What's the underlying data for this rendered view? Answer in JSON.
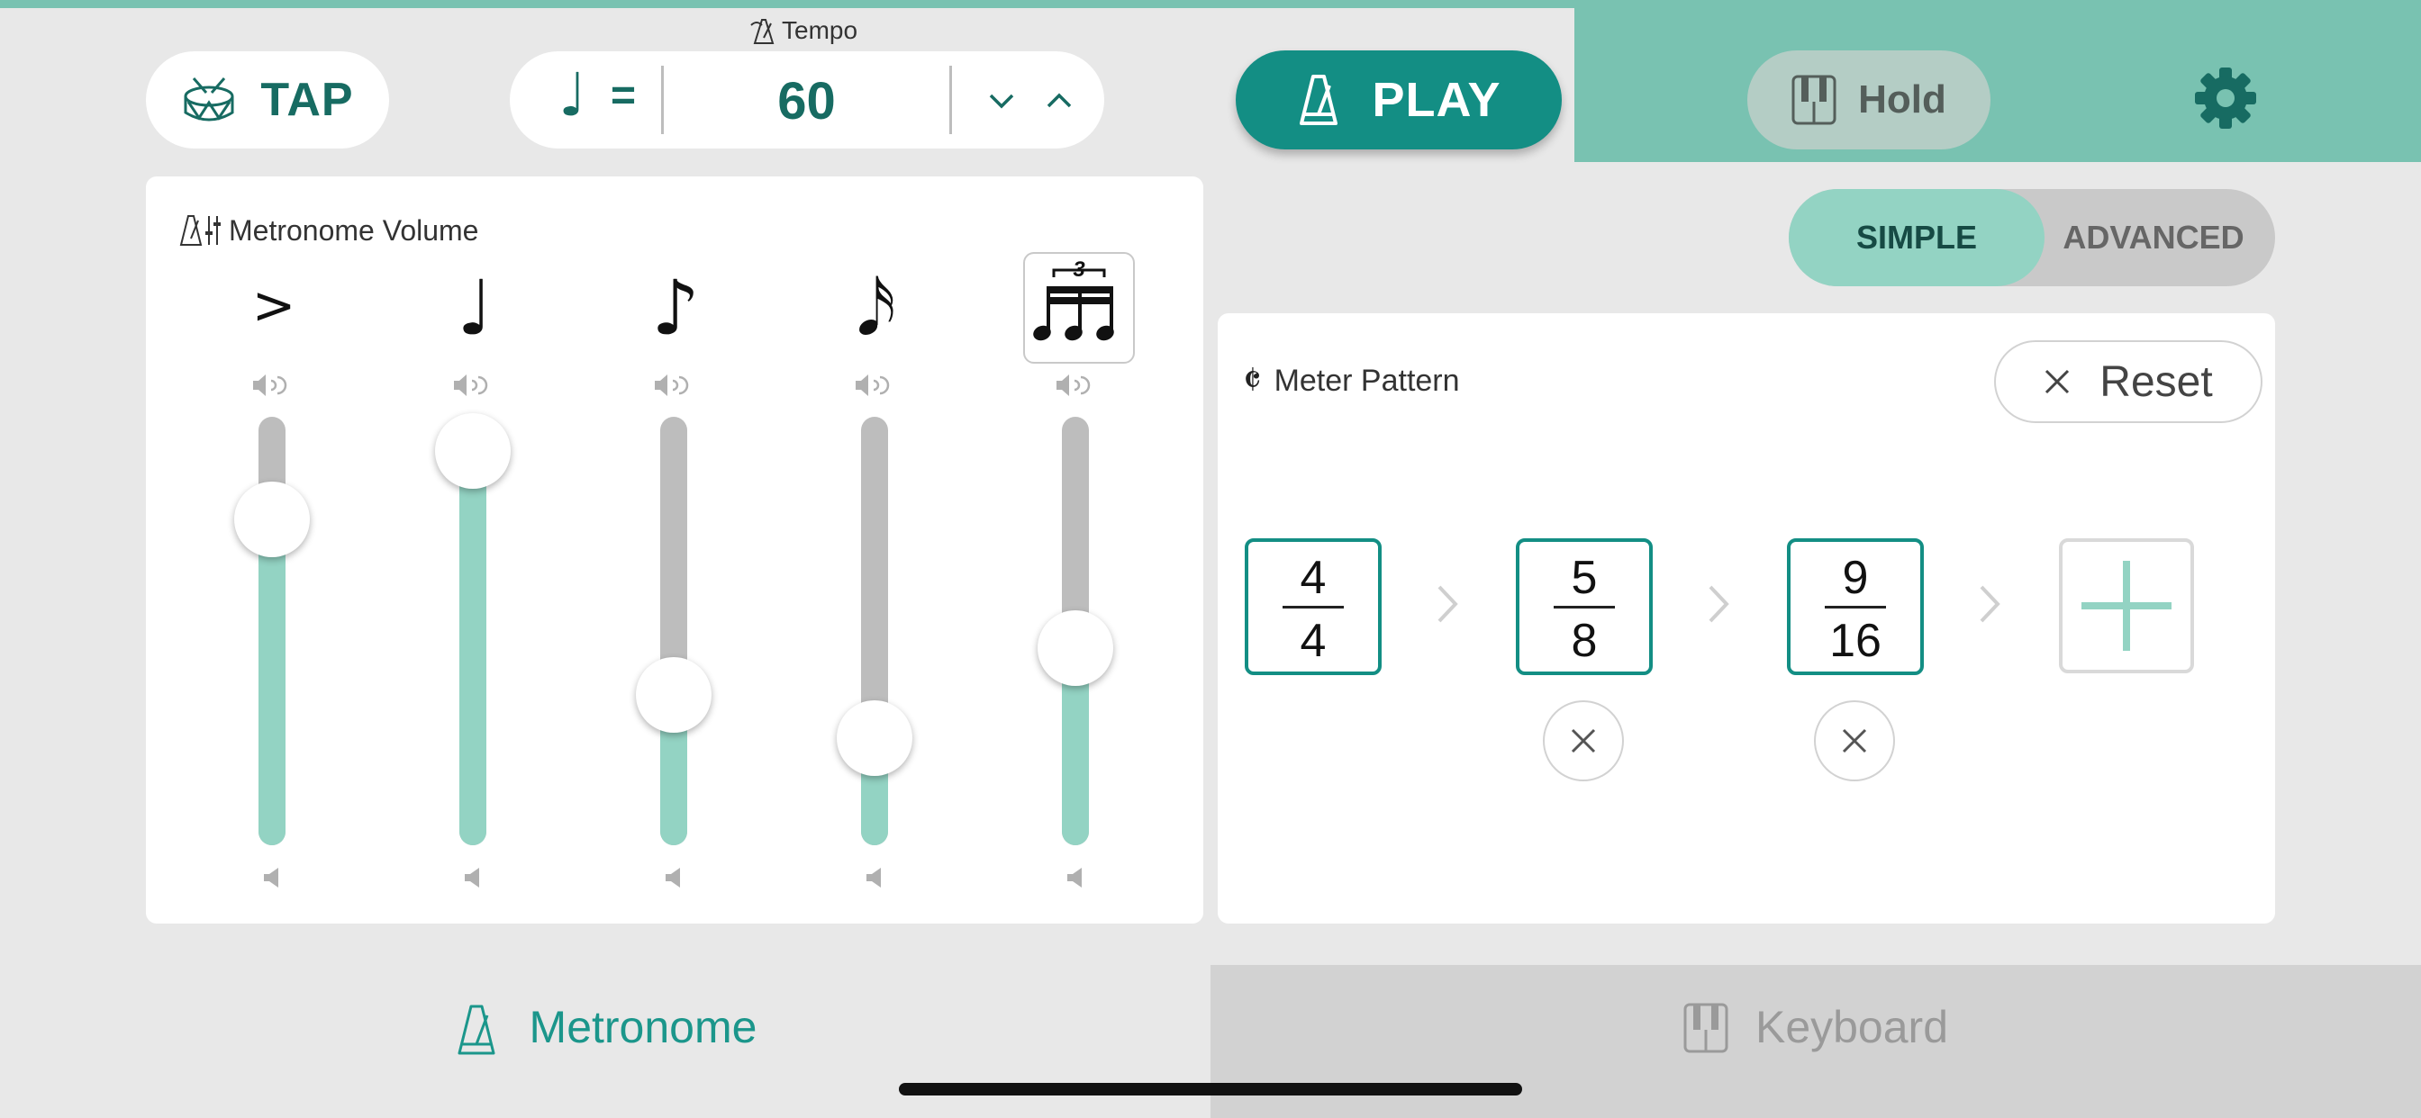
{
  "tempo": {
    "caption": "Tempo",
    "note_symbol": "♩",
    "equals": "=",
    "bpm": "60",
    "decrement_icon": "chevron-down-icon",
    "increment_icon": "chevron-up-icon"
  },
  "toolbar": {
    "tap_label": "TAP",
    "tap_icon": "drum-icon",
    "play_label": "PLAY",
    "play_icon": "metronome-icon",
    "hold_label": "Hold",
    "hold_icon": "piano-keys-icon",
    "settings_icon": "gear-icon"
  },
  "volume": {
    "title": "Metronome Volume",
    "sliders": [
      {
        "symbol": ">",
        "name": "accent",
        "level": 0.76
      },
      {
        "symbol": "♩",
        "name": "quarter",
        "level": 0.92
      },
      {
        "symbol": "♪",
        "name": "eighth",
        "level": 0.35
      },
      {
        "symbol": "𝅘𝅥𝅯",
        "name": "sixteenth",
        "level": 0.25
      },
      {
        "symbol": "3",
        "name": "triplet",
        "level": 0.46
      }
    ]
  },
  "mode": {
    "simple_label": "SIMPLE",
    "advanced_label": "ADVANCED",
    "selected": "SIMPLE"
  },
  "meter": {
    "title": "Meter Pattern",
    "symbol": "𝄵",
    "reset_label": "Reset",
    "patterns": [
      {
        "top": "4",
        "bottom": "4"
      },
      {
        "top": "5",
        "bottom": "8"
      },
      {
        "top": "9",
        "bottom": "16"
      }
    ]
  },
  "tabs": {
    "metronome_label": "Metronome",
    "keyboard_label": "Keyboard",
    "selected": "Metronome"
  },
  "colors": {
    "teal": "#138e84",
    "mint": "#93d3c3",
    "header_green": "#79c2b1"
  }
}
